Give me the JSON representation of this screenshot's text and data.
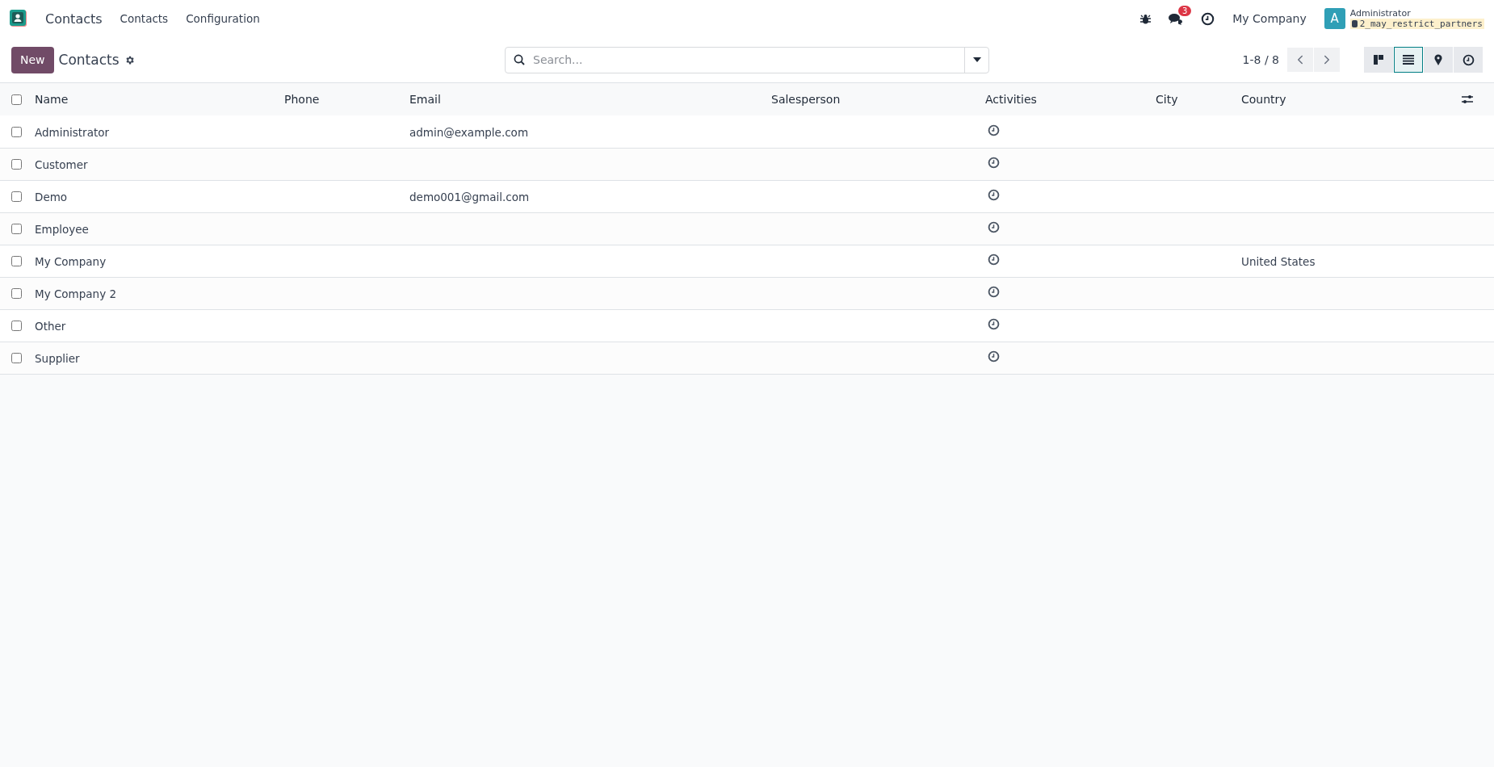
{
  "app": {
    "name": "Contacts"
  },
  "menu": [
    "Contacts",
    "Configuration"
  ],
  "systray": {
    "messages_count": "3",
    "company": "My Company",
    "user_initial": "A",
    "user_name": "Administrator",
    "database": "2_may_restrict_partners"
  },
  "control_panel": {
    "new_button": "New",
    "title": "Contacts",
    "search": {
      "placeholder": "Search..."
    },
    "pager": "1-8 / 8",
    "views": [
      {
        "kind": "kanban",
        "selected": false
      },
      {
        "kind": "list",
        "selected": true
      },
      {
        "kind": "map",
        "selected": false
      },
      {
        "kind": "activity",
        "selected": false
      }
    ]
  },
  "table": {
    "select_all_checked": false,
    "columns": [
      "Name",
      "Phone",
      "Email",
      "Salesperson",
      "Activities",
      "City",
      "Country"
    ],
    "rows": [
      {
        "name": "Administrator",
        "email": "admin@example.com",
        "checked": false
      },
      {
        "name": "Customer",
        "checked": false
      },
      {
        "name": "Demo",
        "email": "demo001@gmail.com",
        "checked": false
      },
      {
        "name": "Employee",
        "checked": false
      },
      {
        "name": "My Company",
        "country": "United States",
        "checked": false
      },
      {
        "name": "My Company 2",
        "checked": false
      },
      {
        "name": "Other",
        "checked": false
      },
      {
        "name": "Supplier",
        "checked": false
      }
    ]
  }
}
